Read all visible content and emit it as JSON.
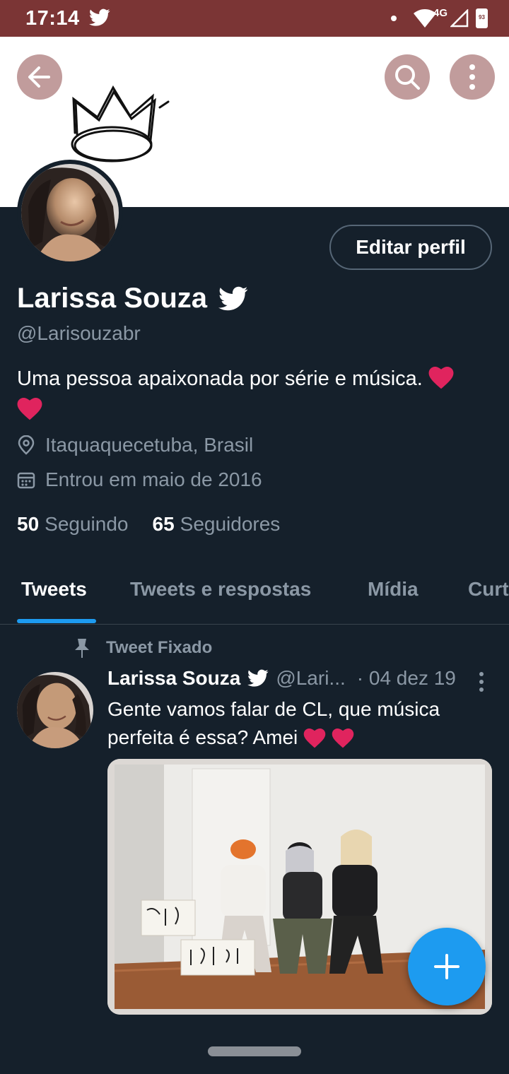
{
  "status_bar": {
    "time": "17:14",
    "network": "4G",
    "battery": "93",
    "icons": [
      "twitter-bird-icon",
      "notification-dot-icon",
      "wifi-icon",
      "signal-icon",
      "battery-icon"
    ]
  },
  "header": {
    "back_icon": "arrow-left-icon",
    "search_icon": "search-icon",
    "more_icon": "more-vertical-icon",
    "banner_art": "crown-sketch"
  },
  "profile": {
    "edit_button": "Editar perfil",
    "name": "Larissa Souza",
    "handle": "@Larisouzabr",
    "bio": "Uma pessoa apaixonada por série e música.",
    "location": "Itaquaquecetuba, Brasil",
    "joined": "Entrou em maio de 2016",
    "following_count": "50",
    "following_label": "Seguindo",
    "followers_count": "65",
    "followers_label": "Seguidores"
  },
  "tabs": [
    {
      "label": "Tweets",
      "active": true
    },
    {
      "label": "Tweets e respostas",
      "active": false
    },
    {
      "label": "Mídia",
      "active": false
    },
    {
      "label": "Curtidas",
      "active": false
    }
  ],
  "pinned_tweet": {
    "pinned_label": "Tweet Fixado",
    "author": "Larissa Souza",
    "handle": "@Lari...",
    "date": "· 04 dez 19",
    "text": "Gente vamos falar de CL, que música perfeita é essa? Amei"
  },
  "colors": {
    "status_bar": "#7b3535",
    "background": "#15202b",
    "accent": "#1d9bf0",
    "secondary_text": "#8b98a5",
    "heart": "#e0245e"
  }
}
